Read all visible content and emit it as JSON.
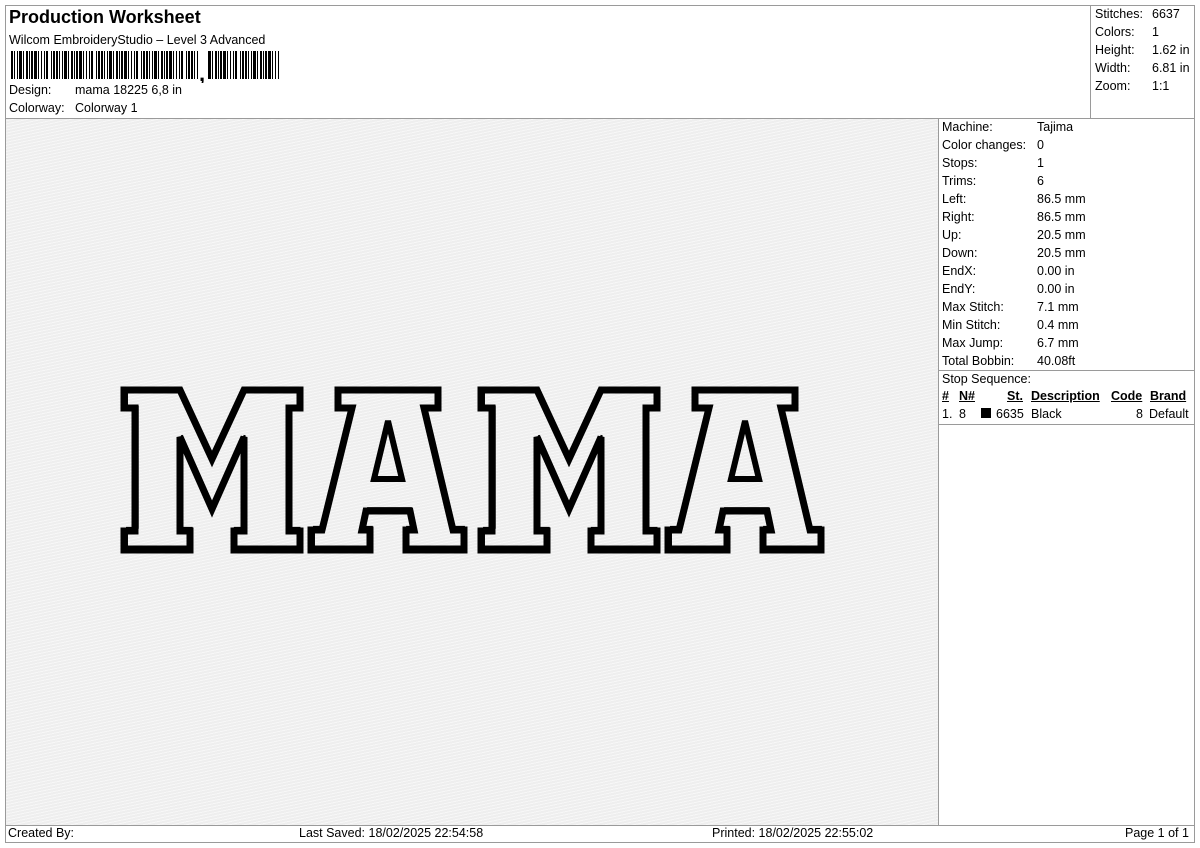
{
  "header": {
    "title": "Production Worksheet",
    "software": "Wilcom EmbroideryStudio – Level 3 Advanced",
    "design_label": "Design:",
    "design_value": "mama 18225 6,8 in",
    "colorway_label": "Colorway:",
    "colorway_value": "Colorway 1"
  },
  "summary": [
    {
      "label": "Stitches:",
      "value": "6637"
    },
    {
      "label": "Colors:",
      "value": "1"
    },
    {
      "label": "Height:",
      "value": "1.62 in"
    },
    {
      "label": "Width:",
      "value": "6.81 in"
    },
    {
      "label": "Zoom:",
      "value": "1:1"
    }
  ],
  "properties": [
    {
      "label": "Machine:",
      "value": "Tajima"
    },
    {
      "label": "Color changes:",
      "value": "0"
    },
    {
      "label": "Stops:",
      "value": "1"
    },
    {
      "label": "Trims:",
      "value": "6"
    },
    {
      "label": "Left:",
      "value": "86.5 mm"
    },
    {
      "label": "Right:",
      "value": "86.5 mm"
    },
    {
      "label": "Up:",
      "value": "20.5 mm"
    },
    {
      "label": "Down:",
      "value": "20.5 mm"
    },
    {
      "label": "EndX:",
      "value": "0.00 in"
    },
    {
      "label": "EndY:",
      "value": "0.00 in"
    },
    {
      "label": "Max Stitch:",
      "value": "7.1 mm"
    },
    {
      "label": "Min Stitch:",
      "value": "0.4 mm"
    },
    {
      "label": "Max Jump:",
      "value": "6.7 mm"
    },
    {
      "label": "Total Bobbin:",
      "value": "40.08ft"
    }
  ],
  "stop_sequence": {
    "title": "Stop Sequence:",
    "columns": [
      "#",
      "N#",
      "St.",
      "Description",
      "Code",
      "Brand"
    ],
    "rows": [
      {
        "index": "1.",
        "n": "8",
        "color": "#000000",
        "stitches": "6635",
        "description": "Black",
        "code": "8",
        "brand": "Default"
      }
    ]
  },
  "design": {
    "text": "MAMA",
    "thread_color": "#000000",
    "fabric_color": "#eeeeee"
  },
  "footer": {
    "created_by": "Created By:",
    "last_saved": "Last Saved: 18/02/2025 22:54:58",
    "printed": "Printed: 18/02/2025 22:55:02",
    "page": "Page 1 of 1"
  }
}
